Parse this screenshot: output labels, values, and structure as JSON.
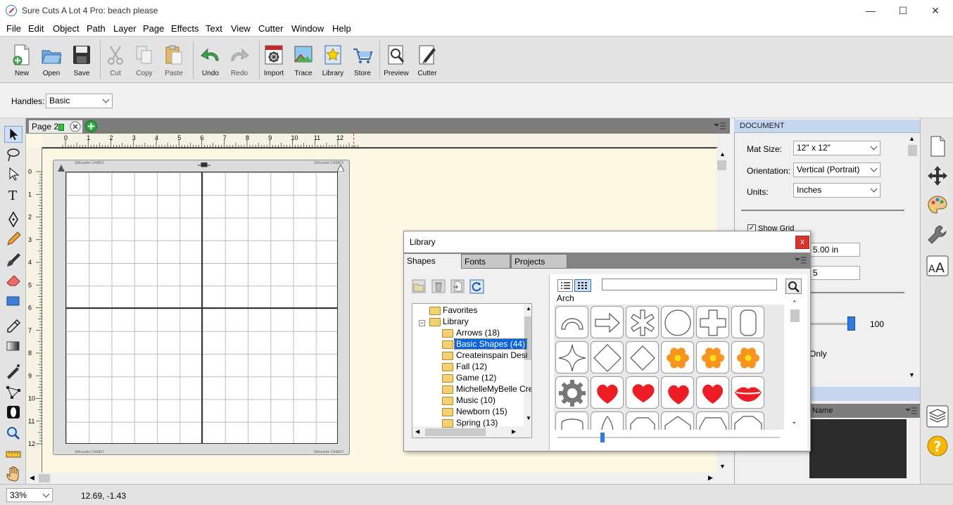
{
  "window": {
    "title": "Sure Cuts A Lot 4 Pro: beach please",
    "minimize": "—",
    "maximize": "☐",
    "close": "✕"
  },
  "menu": [
    "File",
    "Edit",
    "Object",
    "Path",
    "Layer",
    "Page",
    "Effects",
    "Text",
    "View",
    "Cutter",
    "Window",
    "Help"
  ],
  "toolbar": {
    "new": "New",
    "open": "Open",
    "save": "Save",
    "cut": "Cut",
    "copy": "Copy",
    "paste": "Paste",
    "undo": "Undo",
    "redo": "Redo",
    "import": "Import",
    "trace": "Trace",
    "library": "Library",
    "store": "Store",
    "preview": "Preview",
    "cutter": "Cutter"
  },
  "handles": {
    "label": "Handles:",
    "value": "Basic"
  },
  "page_tab": {
    "label": "Page 2"
  },
  "ruler": {
    "h": [
      "0",
      "1",
      "2",
      "3",
      "4",
      "5",
      "6",
      "7",
      "8",
      "9",
      "10",
      "11",
      "12"
    ],
    "v": [
      "0",
      "1",
      "2",
      "3",
      "4",
      "5",
      "6",
      "7",
      "8",
      "9",
      "10",
      "11",
      "12"
    ]
  },
  "mat_caption": "Silhouette CAMEO",
  "status": {
    "zoom": "33%",
    "coords": "12.69, -1.43"
  },
  "document_panel": {
    "header": "DOCUMENT",
    "mat_size_label": "Mat Size:",
    "mat_size_value": "12\" x 12\"",
    "orientation_label": "Orientation:",
    "orientation_value": "Vertical (Portrait)",
    "units_label": "Units:",
    "units_value": "Inches",
    "show_grid": "Show Grid",
    "grid_value": "5.00 in",
    "grid_value2": "5",
    "slider_value": "100",
    "only_label": "Only"
  },
  "layers_panel": {
    "name_col": "Name"
  },
  "library": {
    "title": "Library",
    "close": "x",
    "tabs": [
      "Shapes",
      "Fonts",
      "Projects"
    ],
    "tree": {
      "favorites": "Favorites",
      "library": "Library",
      "children": [
        "Arrows (18)",
        "Basic Shapes (44)",
        "Createinspain Desi",
        "Fall (12)",
        "Game (12)",
        "MichelleMyBelle Cre",
        "Music (10)",
        "Newborn (15)",
        "Spring (13)"
      ],
      "selected_index": 1
    },
    "search_placeholder": "",
    "shape_name": "Arch",
    "shapes": [
      "arch",
      "arrow",
      "asterisk",
      "circle",
      "cross",
      "rounded-rect",
      "star4",
      "diamond",
      "diamond-small",
      "flower-a",
      "flower-b",
      "flower-c",
      "gear",
      "heart-a",
      "heart-b",
      "heart-c",
      "heart-d",
      "lips",
      "rounded-bottom",
      "petal",
      "octagon",
      "pentagon",
      "hexagon",
      "tall-octagon"
    ]
  },
  "colors": {
    "accent": "#3874c6",
    "heart": "#ee1c24",
    "flower": "#f7941d"
  }
}
